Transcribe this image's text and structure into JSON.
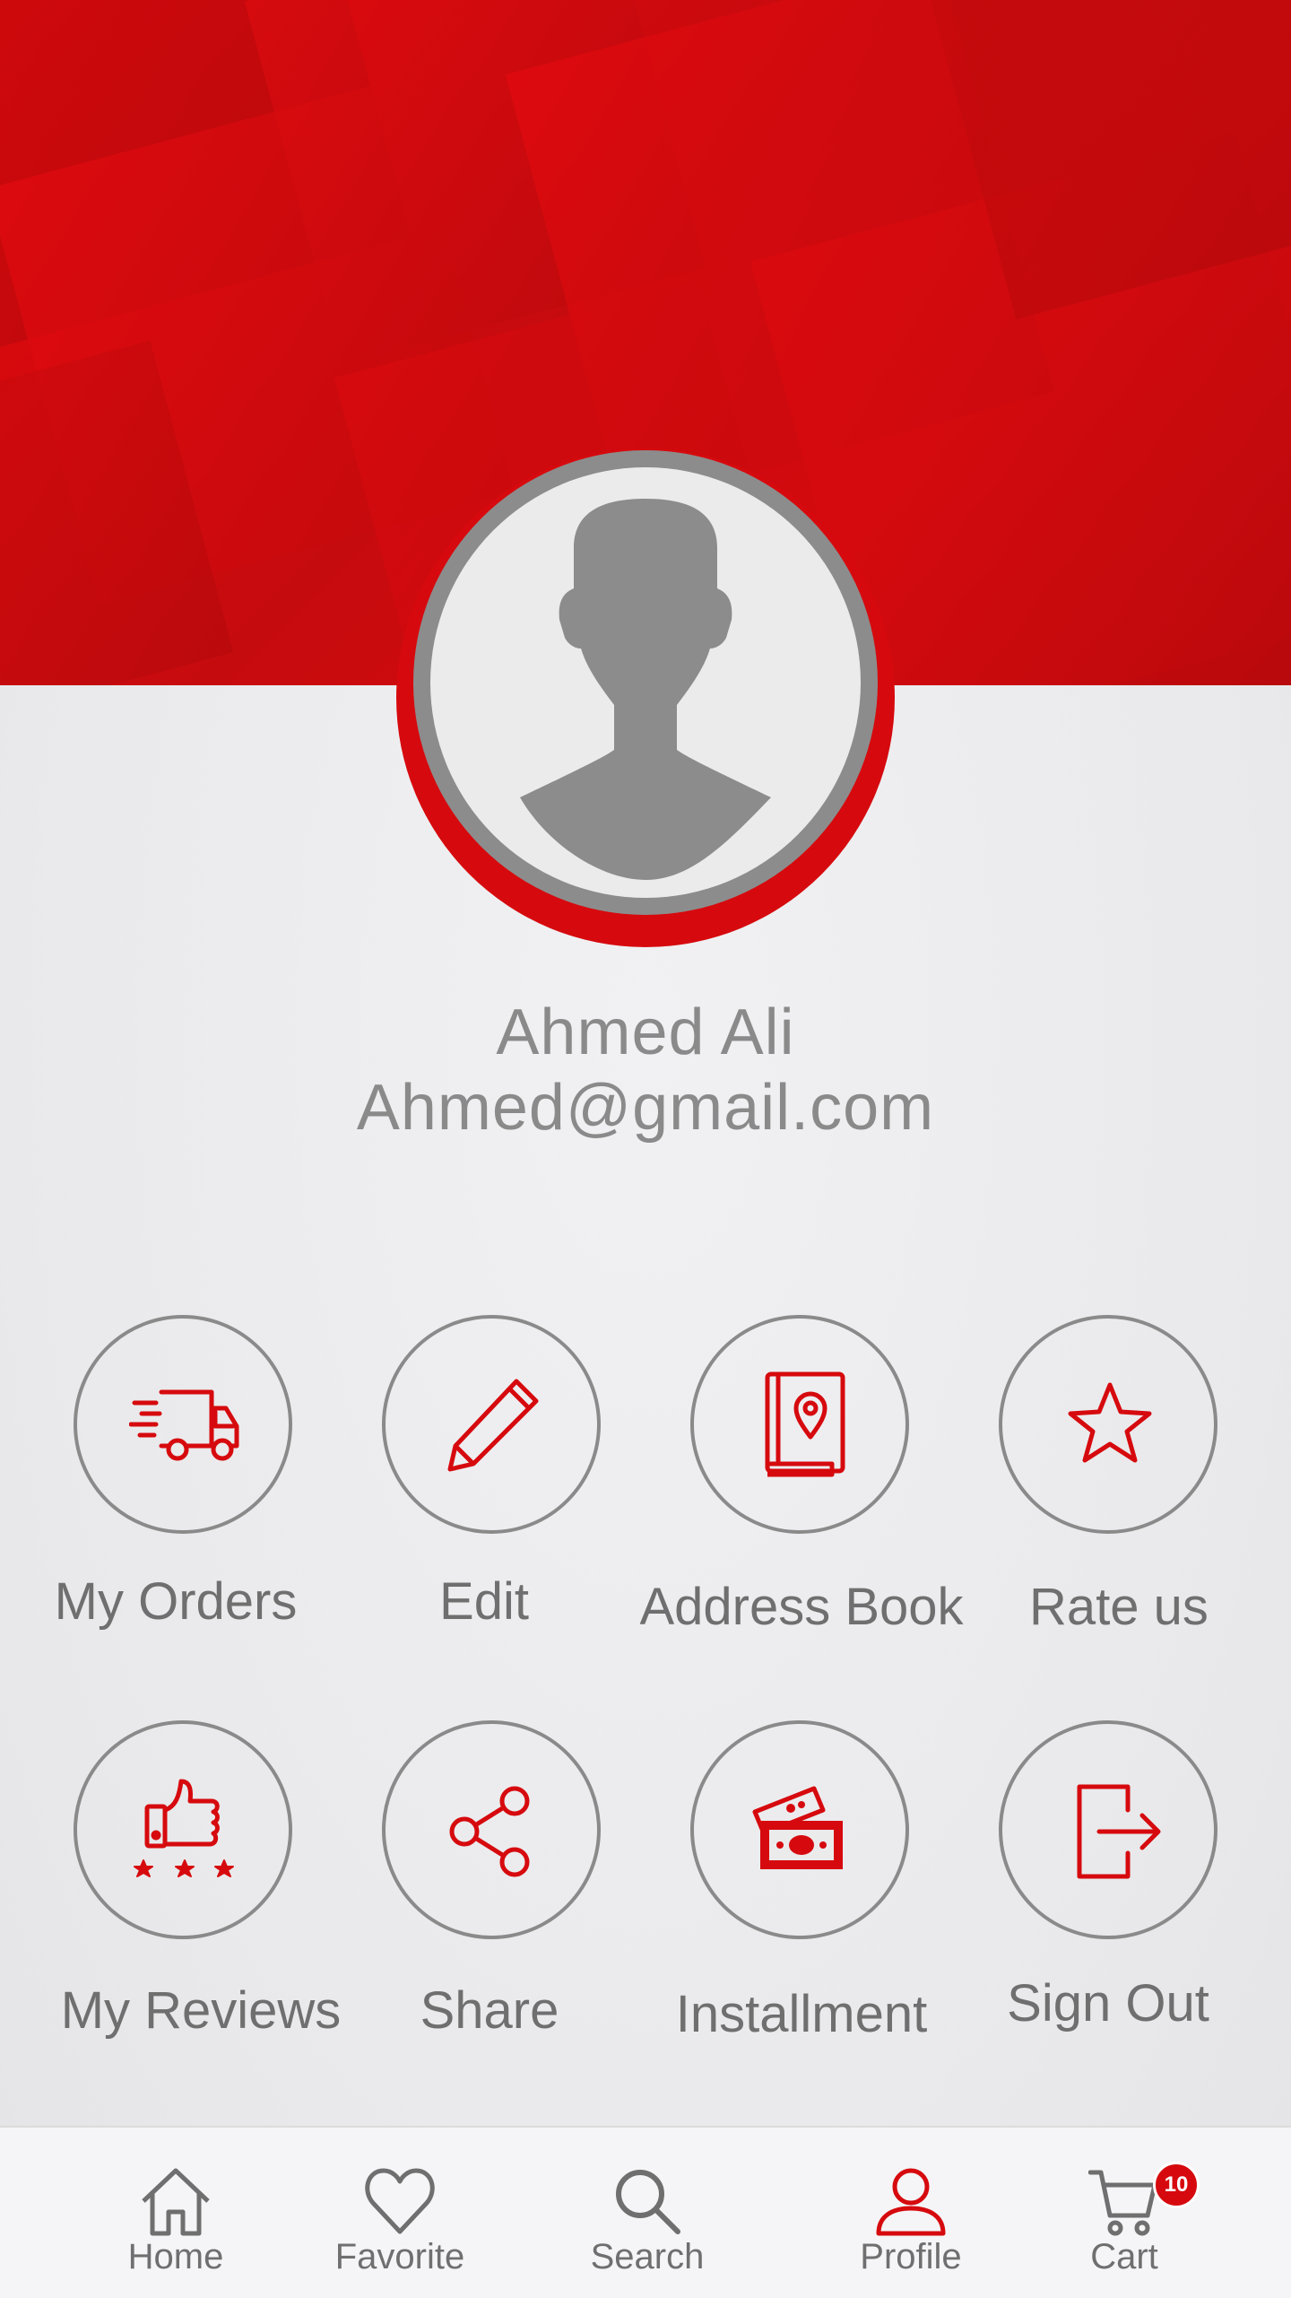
{
  "profile": {
    "name": "Ahmed Ali",
    "email": "Ahmed@gmail.com",
    "avatar_icon": "user-silhouette-icon"
  },
  "menu": {
    "row1": [
      {
        "label": "My Orders",
        "icon": "delivery-truck-icon"
      },
      {
        "label": "Edit",
        "icon": "pencil-icon"
      },
      {
        "label": "Address Book",
        "icon": "address-book-icon"
      },
      {
        "label": "Rate us",
        "icon": "star-icon"
      }
    ],
    "row2": [
      {
        "label": "My Reviews",
        "icon": "thumbs-up-rating-icon"
      },
      {
        "label": "Share",
        "icon": "share-icon"
      },
      {
        "label": "Installment",
        "icon": "money-icon"
      },
      {
        "label": "Sign Out",
        "icon": "sign-out-icon"
      }
    ]
  },
  "nav": {
    "items": [
      {
        "label": "Home",
        "icon": "home-icon"
      },
      {
        "label": "Favorite",
        "icon": "heart-icon"
      },
      {
        "label": "Search",
        "icon": "search-icon"
      },
      {
        "label": "Profile",
        "icon": "user-icon"
      },
      {
        "label": "Cart",
        "icon": "cart-icon"
      }
    ],
    "active": "Profile",
    "cart_count": "10"
  },
  "colors": {
    "accent": "#d60a0e",
    "ring_gray": "#8a8a8a",
    "text_gray": "#6f6f6f"
  }
}
